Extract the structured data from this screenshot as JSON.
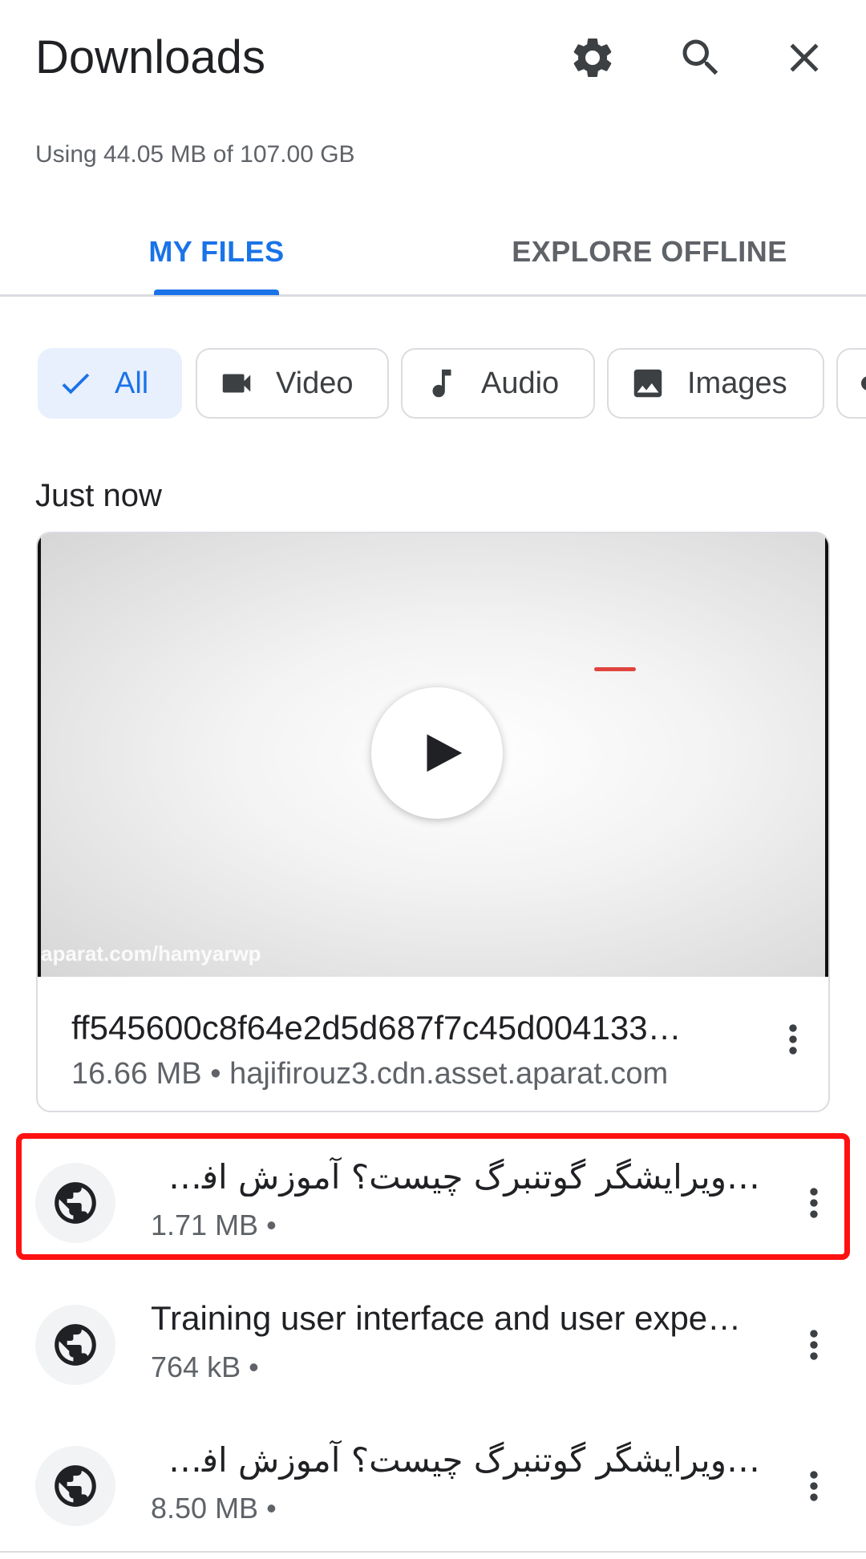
{
  "header": {
    "title": "Downloads",
    "icons": [
      "gear-icon",
      "search-icon",
      "close-icon"
    ]
  },
  "storage_text": "Using 44.05 MB of 107.00 GB",
  "tabs": [
    {
      "label": "MY FILES",
      "selected": true
    },
    {
      "label": "EXPLORE OFFLINE",
      "selected": false
    }
  ],
  "filters": [
    {
      "label": "All",
      "icon": "check-icon",
      "selected": true
    },
    {
      "label": "Video",
      "icon": "videocam-icon",
      "selected": false
    },
    {
      "label": "Audio",
      "icon": "music-note-icon",
      "selected": false
    },
    {
      "label": "Images",
      "icon": "image-icon",
      "selected": false
    }
  ],
  "section_label": "Just now",
  "video_card": {
    "watermark": "aparat.com/hamyarwp",
    "name": "ff545600c8f64e2d5d687f7c45d004133…",
    "meta": "16.66 MB • hajifirouz3.cdn.asset.aparat.com"
  },
  "rows": [
    {
      "name": "…ویرایشگر گوتنبرگ چیست؟ آموزش افزونه گوتن",
      "meta": "1.71 MB •",
      "icon": "globe-icon",
      "highlighted": true
    },
    {
      "name": "Training user interface and user expe…",
      "meta": "764 kB •",
      "icon": "globe-icon",
      "highlighted": false
    },
    {
      "name": "…ویرایشگر گوتنبرگ چیست؟ آموزش افزونه گوتن",
      "meta": "8.50 MB •",
      "icon": "globe-icon",
      "highlighted": false
    }
  ],
  "colors": {
    "accent": "#1a73e8",
    "highlight_border": "#ff1111"
  }
}
